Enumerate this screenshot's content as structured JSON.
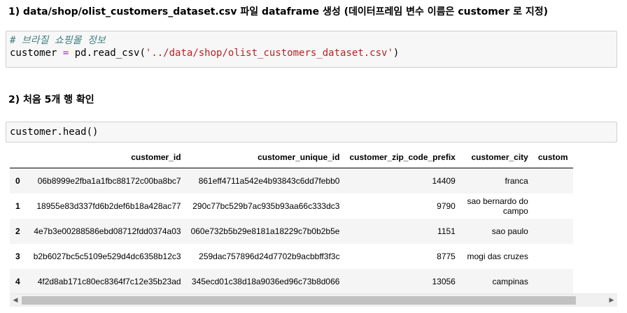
{
  "headings": {
    "h1": "1) data/shop/olist_customers_dataset.csv 파일 dataframe 생성 (데이터프레임 변수 이름은 customer 로 지정)",
    "h2": "2) 처음 5개 행 확인"
  },
  "cell1": {
    "comment": "# 브라질 쇼핑몰 정보",
    "var": "customer",
    "op": " = ",
    "call": "pd.read_csv(",
    "arg": "'../data/shop/olist_customers_dataset.csv'",
    "close": ")"
  },
  "cell2": {
    "code": "customer.head()"
  },
  "table": {
    "columns": [
      "customer_id",
      "customer_unique_id",
      "customer_zip_code_prefix",
      "customer_city",
      "custom"
    ],
    "rows": [
      {
        "index": "0",
        "customer_id": "06b8999e2fba1a1fbc88172c00ba8bc7",
        "customer_unique_id": "861eff4711a542e4b93843c6dd7febb0",
        "zip": "14409",
        "city": "franca"
      },
      {
        "index": "1",
        "customer_id": "18955e83d337fd6b2def6b18a428ac77",
        "customer_unique_id": "290c77bc529b7ac935b93aa66c333dc3",
        "zip": "9790",
        "city": "sao bernardo do campo"
      },
      {
        "index": "2",
        "customer_id": "4e7b3e00288586ebd08712fdd0374a03",
        "customer_unique_id": "060e732b5b29e8181a18229c7b0b2b5e",
        "zip": "1151",
        "city": "sao paulo"
      },
      {
        "index": "3",
        "customer_id": "b2b6027bc5c5109e529d4dc6358b12c3",
        "customer_unique_id": "259dac757896d24d7702b9acbbff3f3c",
        "zip": "8775",
        "city": "mogi das cruzes"
      },
      {
        "index": "4",
        "customer_id": "4f2d8ab171c80ec8364f7c12e35b23ad",
        "customer_unique_id": "345ecd01c38d18a9036ed96c73b8d066",
        "zip": "13056",
        "city": "campinas"
      }
    ]
  },
  "scrollbar": {
    "left_icon": "scroll-left-arrow-icon",
    "right_icon": "scroll-right-arrow-icon",
    "left_glyph": "◀",
    "right_glyph": "▶"
  }
}
